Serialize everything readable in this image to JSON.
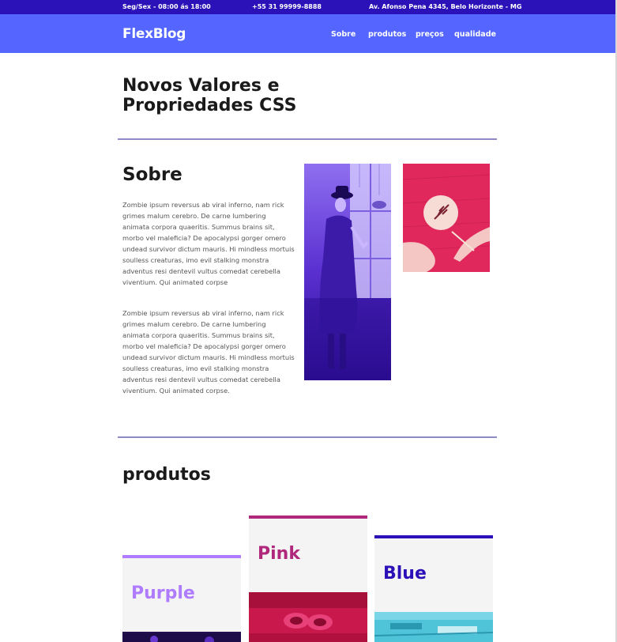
{
  "topbar": {
    "hours": "Seg/Sex - 08:00 ás 18:00",
    "phone": "+55 31 99999-8888",
    "address": "Av. Afonso Pena 4345, Belo Horizonte - MG"
  },
  "nav": {
    "brand": "FlexBlog",
    "links": [
      "Sobre",
      "produtos",
      "preços",
      "qualidade"
    ]
  },
  "page_title": "Novos Valores e Propriedades CSS",
  "sobre": {
    "title": "Sobre",
    "paragraphs": [
      "Zombie ipsum reversus ab viral inferno, nam rick grimes malum cerebro. De carne lumbering animata corpora quaeritis. Summus brains sit, morbo vel maleficia? De apocalypsi gorger omero undead survivor dictum mauris. Hi mindless mortuis soulless creaturas, imo evil stalking monstra adventus resi dentevil vultus comedat cerebella viventium. Qui animated corpse",
      "Zombie ipsum reversus ab viral inferno, nam rick grimes malum cerebro. De carne lumbering animata corpora quaeritis. Summus brains sit, morbo vel maleficia? De apocalypsi gorger omero undead survivor dictum mauris. Hi mindless mortuis soulless creaturas, imo evil stalking monstra adventus resi dentevil vultus comedat cerebella viventium. Qui animated corpse."
    ]
  },
  "produtos": {
    "title": "produtos",
    "cards": [
      {
        "name": "Purple",
        "color": "#b07cff"
      },
      {
        "name": "Pink",
        "color": "#b0287c"
      },
      {
        "name": "Blue",
        "color": "#2c10b8"
      }
    ]
  },
  "colors": {
    "topbar": "#2a12b8",
    "navbar": "#5466ff",
    "divider": "#8e8ac6",
    "card_background": "#f4f4f4"
  }
}
